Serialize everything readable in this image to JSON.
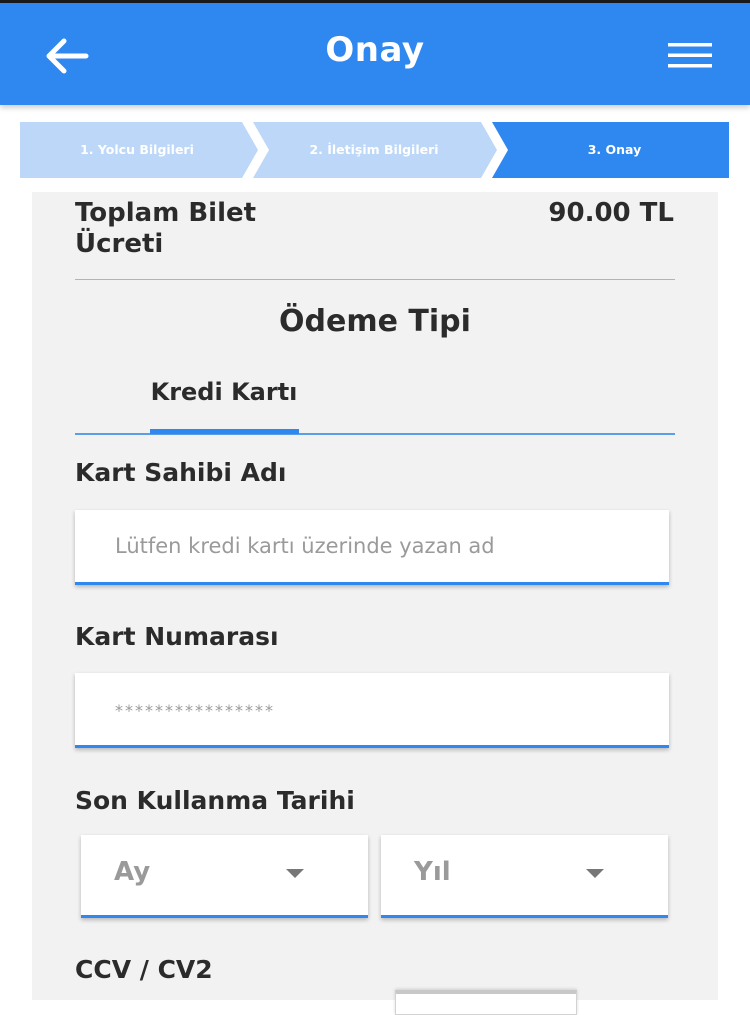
{
  "header": {
    "title": "Onay",
    "back_icon": "arrow-left-icon",
    "menu_icon": "hamburger-menu-icon",
    "color": "#2f87f0"
  },
  "steps": [
    {
      "label": "1. Yolcu Bilgileri",
      "state": "done"
    },
    {
      "label": "2. İletişim Bilgileri",
      "state": "done"
    },
    {
      "label": "3. Onay",
      "state": "active"
    }
  ],
  "summary": {
    "total_label": "Toplam Bilet Ücreti",
    "total_value": "90.00 TL"
  },
  "payment": {
    "title": "Ödeme Tipi",
    "tabs": [
      {
        "label": "Kredi Kartı",
        "active": true
      }
    ]
  },
  "form": {
    "cardholder": {
      "label": "Kart Sahibi Adı",
      "value": "",
      "placeholder": "Lütfen kredi kartı üzerinde yazan ad"
    },
    "card_number": {
      "label": "Kart Numarası",
      "value": "",
      "placeholder": "****************"
    },
    "expiry": {
      "label": "Son Kullanma Tarihi",
      "month": "Ay",
      "year": "Yıl"
    },
    "cvv": {
      "label": "CCV / CV2"
    }
  },
  "colors": {
    "accent": "#2f87f0",
    "step_done": "#bcd7f7",
    "step_active": "#2f87f0",
    "card_background": "#f2f2f2"
  }
}
